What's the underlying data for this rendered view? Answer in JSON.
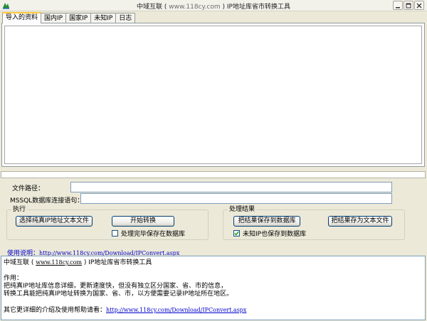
{
  "window": {
    "title_prefix": "中域互联 ( ",
    "title_url": "www.118cy.com",
    "title_suffix": " ) IP地址库省市转换工具"
  },
  "tabs": [
    {
      "label": "导入的资料",
      "active": true
    },
    {
      "label": "国内IP"
    },
    {
      "label": "国家IP"
    },
    {
      "label": "未知IP"
    },
    {
      "label": "日志"
    }
  ],
  "import_text": "",
  "progress": {
    "value_percent": 0
  },
  "form": {
    "file_path_label": "文件路径：",
    "file_path_value": "",
    "mssql_label": "MSSQL数据库连接语句：",
    "mssql_value": ""
  },
  "execute_group": {
    "title": "执行",
    "select_file_button": "选择纯真IP地址文本文件",
    "start_button": "开始转换",
    "save_after_checkbox": {
      "label": "处理完毕保存在数据库",
      "checked": false
    }
  },
  "result_group": {
    "title": "处理结果",
    "save_to_db_button": "把结果保存到数据库",
    "save_to_text_button": "把结果存为文本文件",
    "unknown_ip_checkbox": {
      "label": "未知IP也保存到数据库",
      "checked": true
    }
  },
  "help": {
    "label": "使用说明：",
    "url": "http://www.118cy.com/Download/IPConvert.aspx"
  },
  "info": {
    "line1_prefix": "中域互联 ( ",
    "line1_url": "www.118cy.com",
    "line1_suffix": " ) IP地址库省市转换工具",
    "role_label": "作用：",
    "desc1": "把纯真IP地址库信息详细，更新速度快，但没有独立区分国家、省、市的信息，",
    "desc2": "转换工具能把纯真IP地址转换为国家、省、市，以方便需要记录IP地址所在地区。",
    "more_prefix": "其它更详细的介绍及使用帮助请看：",
    "more_url": "http://www.118cy.com/Download/IPConvert.aspx"
  },
  "colors": {
    "window_bg": "#ece9d8",
    "active_tab_accent": "#ffc83c",
    "link": "#0000cc",
    "button_border": "#003c74"
  }
}
